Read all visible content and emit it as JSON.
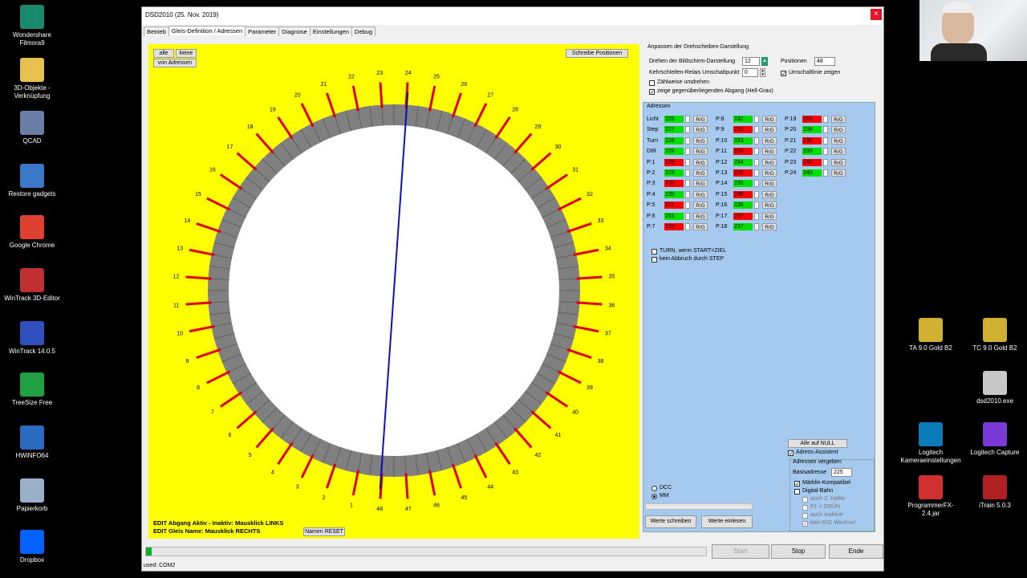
{
  "desktop_left": [
    {
      "label": "Wondershare Filmora9",
      "icon": "filmora-icon",
      "color": "#1a8a6e"
    },
    {
      "label": "3D-Objekte - Verknüpfung",
      "icon": "folder-icon",
      "color": "#e8c050"
    },
    {
      "label": "QCAD",
      "icon": "qcad-icon",
      "color": "#6a7fa8"
    },
    {
      "label": "Restore gadgets",
      "icon": "gadgets-icon",
      "color": "#3a78c8"
    },
    {
      "label": "Google Chrome",
      "icon": "chrome-icon",
      "color": "#e04030"
    },
    {
      "label": "WinTrack 3D-Editor",
      "icon": "wintrack-3d-icon",
      "color": "#c03030"
    },
    {
      "label": "WinTrack 14.0.5",
      "icon": "wintrack-icon",
      "color": "#3050c0"
    },
    {
      "label": "TreeSize Free",
      "icon": "treesize-icon",
      "color": "#20a040"
    },
    {
      "label": "HWiNFO64",
      "icon": "hwinfo-icon",
      "color": "#2a6ac0"
    },
    {
      "label": "Papierkorb",
      "icon": "recycle-bin-icon",
      "color": "#9ab0c8"
    },
    {
      "label": "Dropbox",
      "icon": "dropbox-icon",
      "color": "#0061fe"
    }
  ],
  "desktop_right": [
    {
      "label": "TA 9.0 Gold B2",
      "icon": "ta-gold-icon",
      "color": "#d0b030"
    },
    {
      "label": "TC 9.0 Gold B2",
      "icon": "tc-gold-icon",
      "color": "#d0b030"
    },
    {
      "label": "dsd2010.exe",
      "icon": "dsd-exe-icon",
      "color": "#c8c8c8"
    },
    {
      "label": "Logitech Kameraeinstellungen",
      "icon": "logitech-camera-icon",
      "color": "#0a7ab8"
    },
    {
      "label": "Logitech Capture",
      "icon": "logitech-capture-icon",
      "color": "#7a3ad8"
    },
    {
      "label": "ProgrammerFX-2.4.jar",
      "icon": "java-jar-icon",
      "color": "#d03030"
    },
    {
      "label": "iTrain 5.0.3",
      "icon": "itrain-icon",
      "color": "#b02020"
    }
  ],
  "window": {
    "title": "DSD2010 (25. Nov. 2019)",
    "close_label": "×",
    "tabs": [
      "Betrieb",
      "Gleis-Definition / Adressen",
      "Parameter",
      "Diagnose",
      "Einstellungen",
      "Debug"
    ]
  },
  "canvas": {
    "btn_alle": "alle",
    "btn_keine": "keine",
    "btn_von_adressen": "von Adressen",
    "btn_schreibe": "Schreibe Positionen",
    "edit_line1": "EDIT Abgang Aktiv - Inaktiv: Mausklick LINKS",
    "edit_line2": "EDIT Gleis Name: Mausklick RECHTS",
    "btn_namen_reset": "Namen RESET",
    "ring_colors": {
      "background": "#ffff00",
      "ring": "#808080",
      "inner": "#ffffff",
      "tick": "#e00000",
      "pointer": "#1010c0"
    },
    "track_count": 48,
    "pointer_angle_deg": 184
  },
  "settings": {
    "group_title": "Anpassen der Drehscheiben-Darstellung",
    "drehen_label": "Drehen der Bildschirm-Darstellung",
    "drehen_value": "12",
    "positionen_label": "Positionen",
    "positionen_value": "48",
    "kehrschleifen_label": "Kehrschleifen-Relais Umschaltpunkt",
    "kehrschleifen_value": "0",
    "umschaltlinie_label": "Umschaltlinie zeigen",
    "zaehlweise_label": "Zählweise umdrehen",
    "gegenueber_label": "zeige gegenüberliegenden Abgang (Hell-Grau)"
  },
  "addresses": {
    "title": "Adressen",
    "rg_label": "R/G",
    "col1": [
      {
        "name": "Licht",
        "value": "225",
        "state": "green"
      },
      {
        "name": "Step",
        "value": "227",
        "state": "green"
      },
      {
        "name": "Turn",
        "value": "226",
        "state": "green"
      },
      {
        "name": "DIR",
        "value": "228",
        "state": "green"
      },
      {
        "name": "P:1",
        "value": "229",
        "state": "red"
      },
      {
        "name": "P:2",
        "value": "229",
        "state": "green"
      },
      {
        "name": "P:3",
        "value": "230",
        "state": "red"
      },
      {
        "name": "P:4",
        "value": "230",
        "state": "green"
      },
      {
        "name": "P:5",
        "value": "231",
        "state": "red"
      },
      {
        "name": "P:6",
        "value": "231",
        "state": "green"
      },
      {
        "name": "P:7",
        "value": "232",
        "state": "red"
      }
    ],
    "col2": [
      {
        "name": "P:8",
        "value": "232",
        "state": "green"
      },
      {
        "name": "P:9",
        "value": "233",
        "state": "red"
      },
      {
        "name": "P:10",
        "value": "233",
        "state": "green"
      },
      {
        "name": "P:11",
        "value": "234",
        "state": "red"
      },
      {
        "name": "P:12",
        "value": "234",
        "state": "green"
      },
      {
        "name": "P:13",
        "value": "235",
        "state": "red"
      },
      {
        "name": "P:14",
        "value": "235",
        "state": "green"
      },
      {
        "name": "P:15",
        "value": "236",
        "state": "red"
      },
      {
        "name": "P:16",
        "value": "236",
        "state": "green"
      },
      {
        "name": "P:17",
        "value": "237",
        "state": "red"
      },
      {
        "name": "P:18",
        "value": "237",
        "state": "green"
      }
    ],
    "col3": [
      {
        "name": "P:19",
        "value": "238",
        "state": "red"
      },
      {
        "name": "P:20",
        "value": "238",
        "state": "green"
      },
      {
        "name": "P:21",
        "value": "239",
        "state": "red"
      },
      {
        "name": "P:22",
        "value": "239",
        "state": "green"
      },
      {
        "name": "P:23",
        "value": "240",
        "state": "red"
      },
      {
        "name": "P:24",
        "value": "240",
        "state": "green"
      }
    ],
    "turn_label": "TURN, wenn START=ZIEL",
    "abbruch_label": "kein Abbruch durch STEP",
    "dcc_label": "DCC",
    "mm_label": "MM",
    "btn_schreiben": "Werte schreiben",
    "btn_einlesen": "Werte einlesen",
    "btn_null": "Alle auf NULL",
    "assistent_label": "Adress-Assistent",
    "vergeben_title": "Adressen vergeben",
    "basis_label": "Basisadresse",
    "basis_value": "225",
    "maerklin_label": "Märklin-Kompatibel",
    "digital_label": "Digital-Bahn",
    "haelfte_label": "auch 2. Hälfte",
    "p1gruen_label": "P1 = GRÜN",
    "inaktive_label": "auch inaktive",
    "kein_rg_label": "kein R/G Wechsel",
    "green": "#00e000",
    "red": "#ff0000"
  },
  "bottom": {
    "btn_start": "Start",
    "btn_stop": "Stop",
    "btn_ende": "Ende",
    "status": "used: COM2",
    "progress": 0.01
  }
}
